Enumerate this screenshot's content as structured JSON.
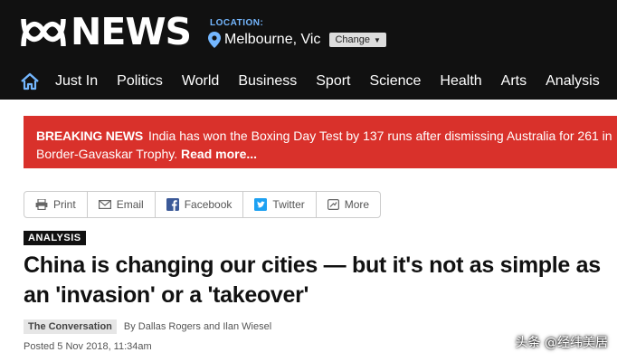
{
  "header": {
    "logo_text": "NEWS",
    "location_label": "LOCATION:",
    "location_city": "Melbourne, Vic",
    "change_label": "Change"
  },
  "nav": {
    "items": [
      "Just In",
      "Politics",
      "World",
      "Business",
      "Sport",
      "Science",
      "Health",
      "Arts",
      "Analysis"
    ]
  },
  "breaking": {
    "tag": "BREAKING NEWS",
    "text": "India has won the Boxing Day Test by 137 runs after dismissing Australia for 261 in Border-Gavaskar Trophy.",
    "read_more": "Read more..."
  },
  "share": {
    "print": "Print",
    "email": "Email",
    "facebook": "Facebook",
    "twitter": "Twitter",
    "more": "More"
  },
  "article": {
    "label": "ANALYSIS",
    "headline": "China is changing our cities — but it's not as simple as an 'invasion' or a 'takeover'",
    "source": "The Conversation",
    "byline": "By Dallas Rogers and Ilan Wiesel",
    "posted": "Posted 5 Nov 2018, 11:34am"
  },
  "watermark": "头条 @经纬美居",
  "colors": {
    "header_bg": "#111111",
    "breaking_bg": "#d9312b",
    "location_label": "#74b7ff",
    "facebook": "#3b5998",
    "twitter": "#1da1f2"
  }
}
